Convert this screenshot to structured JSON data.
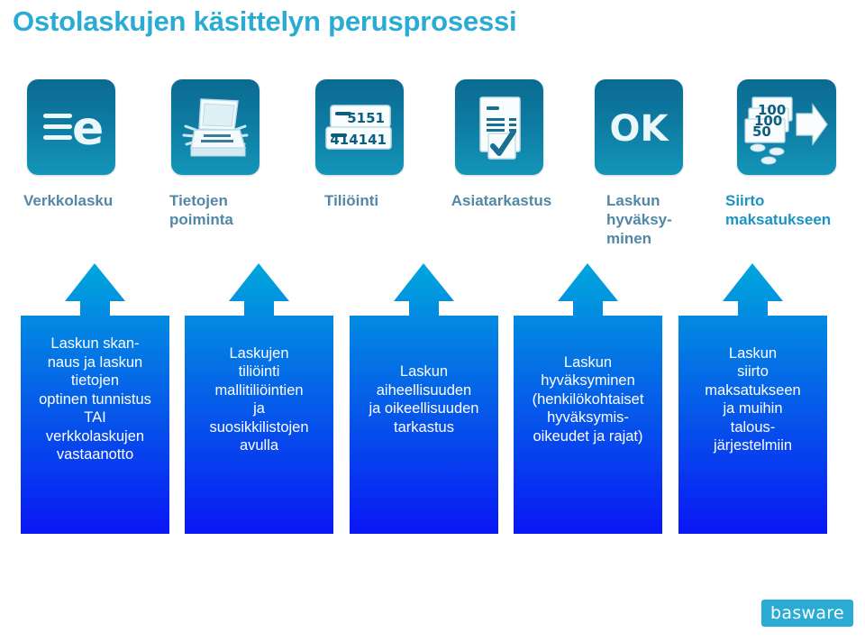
{
  "slide": {
    "title": "Ostolaskujen käsittelyn perusprosessi",
    "background": "#ffffff",
    "title_color": "#29ABD3"
  },
  "colors": {
    "title_cyan": "#29ABD3",
    "label_steel_blue": "#5288A5",
    "label_accent": "#1C93C4",
    "icon_tile_top": "#0B6B92",
    "icon_tile_bottom": "#1395B8",
    "arrow_top": "#00A7DC",
    "arrow_bottom": "#0A17F5",
    "logo_cyan": "#29ABD3"
  },
  "icons": [
    {
      "name": "e-invoice-icon",
      "glyph": "e-with-lines",
      "caption": "Verkkolasku"
    },
    {
      "name": "scanner-icon",
      "glyph": "flatbed-scanner",
      "caption": "Tietojen poiminta"
    },
    {
      "name": "account-codes-icon",
      "glyph": "coding-rows",
      "caption": "Tiliöinti",
      "code_top": "5151",
      "code_bottom": "414141"
    },
    {
      "name": "document-check-icon",
      "glyph": "doc-with-check",
      "caption": "Asiatarkastus"
    },
    {
      "name": "ok-stamp-icon",
      "glyph": "ok-text",
      "caption": "Laskun hyväksyminen",
      "text": "OK"
    },
    {
      "name": "payment-transfer-icon",
      "glyph": "bills-and-arrow",
      "caption": "Siirto maksatukseen",
      "bills": [
        "100",
        "100",
        "50"
      ]
    }
  ],
  "step_labels": [
    {
      "text": "Verkkolasku",
      "accent": false
    },
    {
      "text": "Tietojen\npoiminta",
      "accent": false
    },
    {
      "text": "Tiliöinti",
      "accent": false
    },
    {
      "text": "Asiatarkastus",
      "accent": false
    },
    {
      "text": "Laskun\nhyväksy-\nminen",
      "accent": false
    },
    {
      "text": "Siirto\nmaksatukseen",
      "accent": true
    }
  ],
  "arrows": [
    {
      "text": "Laskun skan-\nnaus ja laskun\ntietojen\noptinen tunnistus\nTAI\nverkkolaskujen\nvastaanotto"
    },
    {
      "text": "Laskujen\ntiliöinti\nmallitiliöintien\nja\nsuosikkilistojen\navulla"
    },
    {
      "text": "Laskun\naiheellisuuden\nja oikeellisuuden\ntarkastus"
    },
    {
      "text": "Laskun\nhyväksyminen\n(henkilökohtaiset\nhyväksymis-\noikeudet ja rajat)"
    },
    {
      "text": "Laskun\nsiirto\nmaksatukseen\nja muihin\ntalous-\njärjestelmiin"
    }
  ],
  "logo": {
    "text": "basware"
  }
}
